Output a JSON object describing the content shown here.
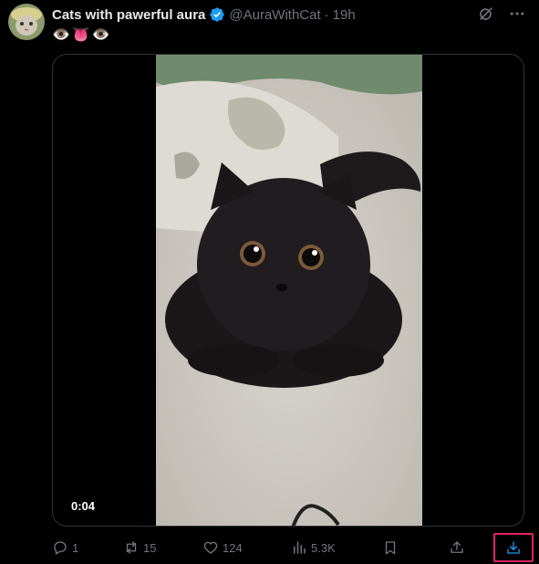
{
  "tweet": {
    "display_name": "Cats with pawerful aura",
    "handle": "@AuraWithCat",
    "separator": "·",
    "time": "19h",
    "text": "👁️👅👁️"
  },
  "media": {
    "duration": "0:04"
  },
  "actions": {
    "reply_count": "1",
    "repost_count": "15",
    "like_count": "124",
    "views_count": "5.3K"
  },
  "colors": {
    "background": "#000000",
    "text_primary": "#e7e9ea",
    "text_secondary": "#71767b",
    "verified_blue": "#1d9bf0",
    "highlight_border": "#e0245e"
  },
  "icons": {
    "verified": "verified-badge-icon",
    "grok": "grok-icon",
    "more": "more-icon",
    "reply": "reply-icon",
    "repost": "repost-icon",
    "like": "heart-icon",
    "views": "views-icon",
    "bookmark": "bookmark-icon",
    "share": "share-icon",
    "download": "download-icon"
  }
}
